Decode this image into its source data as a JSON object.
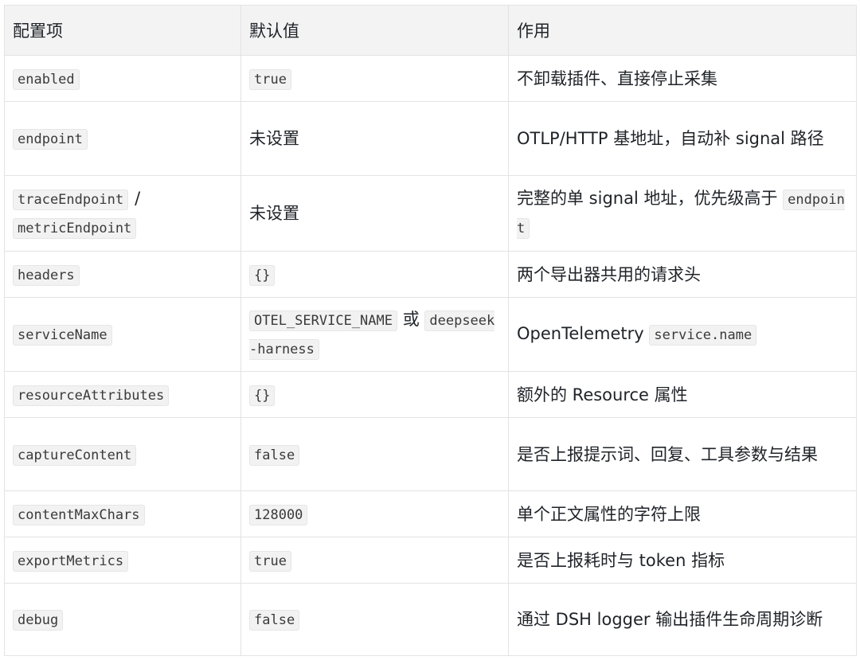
{
  "table": {
    "headers": [
      "配置项",
      "默认值",
      "作用"
    ],
    "rows": [
      {
        "key": "enabled",
        "default_code": "true",
        "desc": "不卸载插件、直接停止采集"
      },
      {
        "key": "endpoint",
        "default_text": "未设置",
        "desc": "OTLP/HTTP 基地址，自动补 signal 路径"
      },
      {
        "key": "traceEndpoint",
        "key_sep": "/",
        "key2": "metricEndpoint",
        "default_text": "未设置",
        "desc": "完整的单 signal 地址，优先级高于",
        "desc_code": "endpoint"
      },
      {
        "key": "headers",
        "default_code": "{}",
        "desc": "两个导出器共用的请求头"
      },
      {
        "key": "serviceName",
        "default_code": "OTEL_SERVICE_NAME",
        "default_sep": "或",
        "default_code2": "deepseek-harness",
        "desc": "OpenTelemetry",
        "desc_code": "service.name"
      },
      {
        "key": "resourceAttributes",
        "default_code": "{}",
        "desc": "额外的 Resource 属性"
      },
      {
        "key": "captureContent",
        "default_code": "false",
        "desc": "是否上报提示词、回复、工具参数与结果"
      },
      {
        "key": "contentMaxChars",
        "default_code": "128000",
        "desc": "单个正文属性的字符上限"
      },
      {
        "key": "exportMetrics",
        "default_code": "true",
        "desc": "是否上报耗时与 token 指标"
      },
      {
        "key": "debug",
        "default_code": "false",
        "desc": "通过 DSH logger 输出插件生命周期诊断"
      }
    ]
  }
}
